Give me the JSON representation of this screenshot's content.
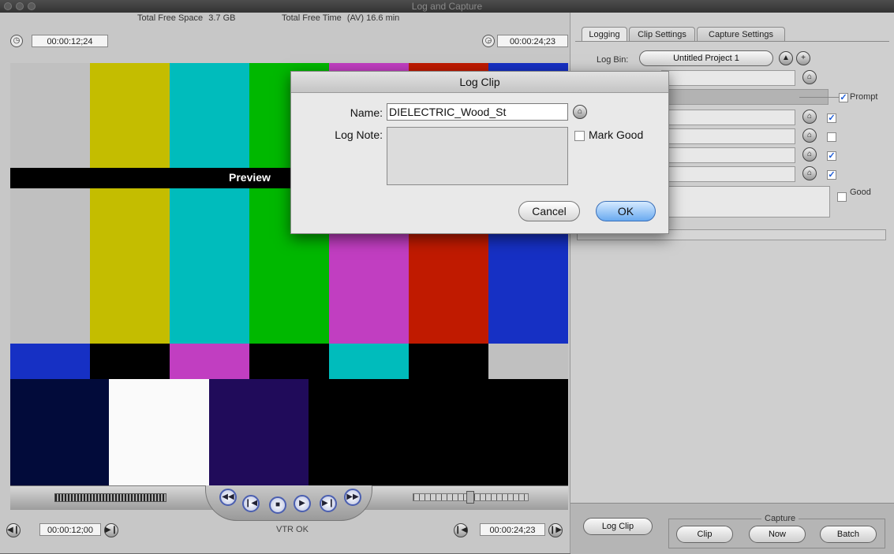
{
  "window": {
    "title": "Log and Capture"
  },
  "info": {
    "free_space_label": "Total Free Space",
    "free_space_value": "3.7 GB",
    "free_time_label": "Total Free Time",
    "free_time_value": "(AV) 16.6 min"
  },
  "timecodes": {
    "duration": "00:00:12;24",
    "current": "00:00:24;23",
    "in_point": "00:00:12;00",
    "out_point": "00:00:24;23"
  },
  "preview": {
    "overlay_text": "Preview",
    "status": "VTR OK"
  },
  "tabs": [
    {
      "label": "Logging"
    },
    {
      "label": "Clip Settings"
    },
    {
      "label": "Capture Settings"
    }
  ],
  "logging": {
    "log_bin_label": "Log Bin:",
    "log_bin_value": "Untitled Project 1",
    "prompt_label": "Prompt",
    "good_label": "Good"
  },
  "buttons": {
    "log_clip": "Log Clip",
    "capture_group": "Capture",
    "clip": "Clip",
    "now": "Now",
    "batch": "Batch"
  },
  "dialog": {
    "title": "Log Clip",
    "name_label": "Name:",
    "name_value": "DIELECTRIC_Wood_St",
    "log_note_label": "Log Note:",
    "mark_good_label": "Mark Good",
    "cancel": "Cancel",
    "ok": "OK"
  },
  "colors": {
    "bar_gray": "#c0c0c0",
    "bar_yellow": "#c4bd00",
    "bar_cyan": "#00bcbc",
    "bar_green": "#00b800",
    "bar_magenta": "#c13ec1",
    "bar_red": "#c01a00",
    "bar_blue": "#1630c4",
    "accent_blue": "#4e86e0"
  }
}
